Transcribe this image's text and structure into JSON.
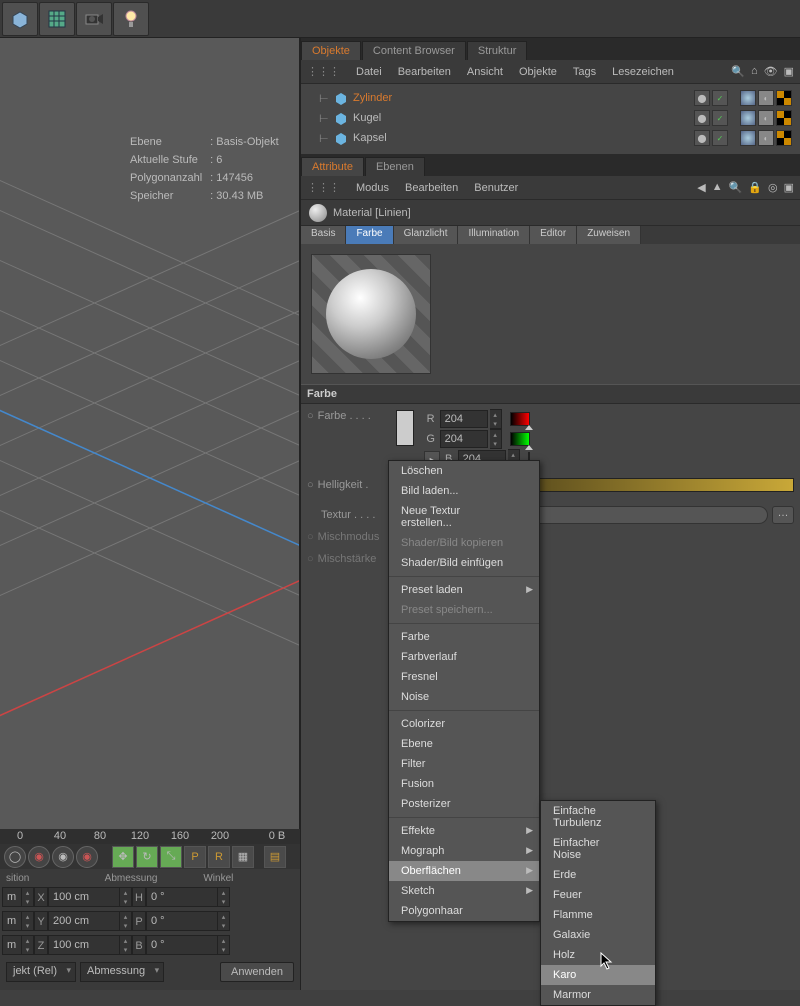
{
  "toolbar_icons": [
    "cube",
    "grid",
    "camera",
    "light"
  ],
  "tabs_objects": {
    "objekte": "Objekte",
    "content": "Content Browser",
    "struktur": "Struktur"
  },
  "obj_menu": [
    "Datei",
    "Bearbeiten",
    "Ansicht",
    "Objekte",
    "Tags",
    "Lesezeichen"
  ],
  "objects": [
    {
      "name": "Zylinder",
      "selected": true
    },
    {
      "name": "Kugel",
      "selected": false
    },
    {
      "name": "Kapsel",
      "selected": false
    }
  ],
  "tabs_attr": {
    "attribute": "Attribute",
    "ebenen": "Ebenen"
  },
  "attr_menu": [
    "Modus",
    "Bearbeiten",
    "Benutzer"
  ],
  "material_title": "Material [Linien]",
  "channels": [
    "Basis",
    "Farbe",
    "Glanzlicht",
    "Illumination",
    "Editor",
    "Zuweisen"
  ],
  "section_farbe": "Farbe",
  "label_farbe": "Farbe . . . .",
  "label_helligkeit": "Helligkeit .",
  "label_textur": "Textur . . . .",
  "label_mischmodus": "Mischmodus",
  "label_mischstaerke": "Mischstärke",
  "rgb": {
    "r_lbl": "R",
    "g_lbl": "G",
    "b_lbl": "B",
    "r": "204",
    "g": "204",
    "b": "204"
  },
  "brightness": "100 %",
  "stats": {
    "ebene_l": "Ebene",
    "ebene_v": ": Basis-Objekt",
    "stufe_l": "Aktuelle Stufe",
    "stufe_v": ": 6",
    "poly_l": "Polygonanzahl",
    "poly_v": ": 147456",
    "speicher_l": "Speicher",
    "speicher_v": ": 30.43 MB"
  },
  "ruler": [
    "",
    "0",
    "40",
    "80",
    "120",
    "160",
    "200"
  ],
  "ruler_right": "0 B",
  "coord_headers": [
    "sition",
    "Abmessung",
    "Winkel"
  ],
  "coords": [
    {
      "axis": "X",
      "pos": "m",
      "dim": "100 cm",
      "ang": "0 °",
      "dl": "H"
    },
    {
      "axis": "Y",
      "pos": "m",
      "dim": "200 cm",
      "ang": "0 °",
      "dl": "P"
    },
    {
      "axis": "Z",
      "pos": "m",
      "dim": "100 cm",
      "ang": "0 °",
      "dl": "B"
    }
  ],
  "coord_footer": {
    "left": "jekt (Rel)",
    "mid": "Abmessung",
    "btn": "Anwenden"
  },
  "menu1": [
    {
      "t": "Löschen"
    },
    {
      "t": "Bild laden..."
    },
    {
      "t": "Neue Textur erstellen..."
    },
    {
      "t": "Shader/Bild kopieren",
      "dis": true
    },
    {
      "t": "Shader/Bild einfügen"
    },
    {
      "sep": true
    },
    {
      "t": "Preset laden",
      "sub": true
    },
    {
      "t": "Preset speichern...",
      "dis": true
    },
    {
      "sep": true
    },
    {
      "t": "Farbe"
    },
    {
      "t": "Farbverlauf"
    },
    {
      "t": "Fresnel"
    },
    {
      "t": "Noise"
    },
    {
      "sep": true
    },
    {
      "t": "Colorizer"
    },
    {
      "t": "Ebene"
    },
    {
      "t": "Filter"
    },
    {
      "t": "Fusion"
    },
    {
      "t": "Posterizer"
    },
    {
      "sep": true
    },
    {
      "t": "Effekte",
      "sub": true
    },
    {
      "t": "Mograph",
      "sub": true
    },
    {
      "t": "Oberflächen",
      "sub": true,
      "hl": true
    },
    {
      "t": "Sketch",
      "sub": true
    },
    {
      "t": "Polygonhaar"
    }
  ],
  "menu2": [
    {
      "t": "Einfache Turbulenz"
    },
    {
      "t": "Einfacher Noise"
    },
    {
      "t": "Erde"
    },
    {
      "t": "Feuer"
    },
    {
      "t": "Flamme"
    },
    {
      "t": "Galaxie"
    },
    {
      "t": "Holz"
    },
    {
      "t": "Karo",
      "hl": true
    },
    {
      "t": "Marmor"
    }
  ]
}
